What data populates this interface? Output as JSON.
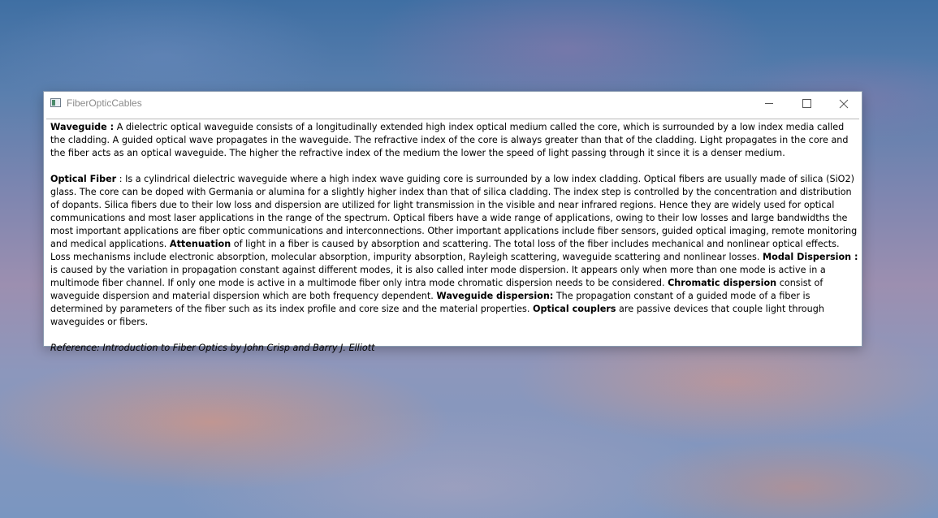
{
  "window": {
    "title": "FiberOpticCables",
    "controls": {
      "minimize": "minimize-icon",
      "maximize": "maximize-icon",
      "close": "close-icon"
    }
  },
  "content": {
    "waveguide": {
      "term": "Waveguide :",
      "text": "  A dielectric optical waveguide consists of a longitudinally extended high index optical medium called the core, which is surrounded by a low index media called the cladding. A guided optical wave propagates in the waveguide.    The refractive index of the core is always greater than that of the cladding. Light propagates in the core and the fiber acts as an optical waveguide. The higher the refractive index of the medium the lower the speed of light passing through it since it is a denser medium."
    },
    "optical_fiber": {
      "term": "Optical Fiber",
      "text1": " : Is a cylindrical dielectric waveguide where  a high index wave guiding core is surrounded by a low index cladding. Optical fibers are usually made of silica (SiO2) glass.   The core can be doped with  Germania or alumina for a slightly higher index than that of silica cladding.  The index step is controlled by the concentration and distribution of dopants. Silica fibers due to their low loss and dispersion are utilized for light transmission in the visible and near infrared regions.  Hence they are widely used for optical communications and most laser applications in the range of the spectrum.  Optical fibers have a wide range of applications, owing to their low losses and large bandwidths the most important applications are fiber optic communications and interconnections. Other important applications include fiber sensors, guided optical imaging, remote monitoring and medical applications.  ",
      "attenuation_term": "Attenuation",
      "text2": "  of light in a fiber is caused by absorption and scattering.  The total loss of the fiber includes mechanical and nonlinear optical effects.  Loss mechanisms include electronic absorption, molecular absorption, impurity absorption, Rayleigh scattering, waveguide scattering and nonlinear losses.  ",
      "modal_term": "Modal Dispersion :",
      "text3": "  is caused by the variation in propagation constant against different modes, it is also called inter mode dispersion. It appears only when more than one mode is active in a multimode fiber channel. If only one mode is active in a multimode fiber only intra mode chromatic dispersion needs to be considered.  ",
      "chromatic_term": "Chromatic dispersion",
      "text4": "  consist of waveguide dispersion and material dispersion which are both frequency dependent.  ",
      "waveguide_dispersion_term": "Waveguide dispersion:",
      "text5": "  The propagation constant of a guided mode of a fiber is determined by parameters of the fiber such as its index profile and core size and the material properties.   ",
      "couplers_term": "Optical couplers",
      "text6": "  are passive devices that couple light through waveguides or fibers."
    },
    "reference": "Reference: Introduction to Fiber Optics by John Crisp and Barry J. Elliott"
  }
}
